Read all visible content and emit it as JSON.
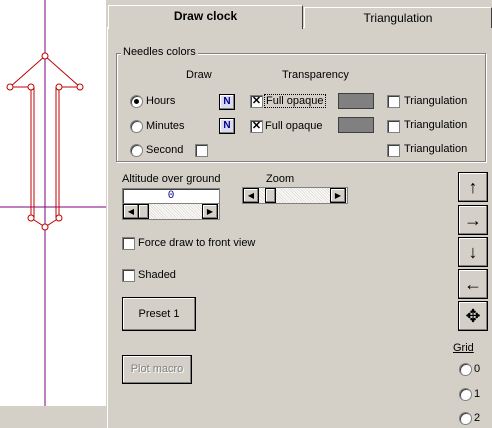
{
  "tabs": {
    "draw_clock": "Draw clock",
    "triangulation": "Triangulation"
  },
  "needles": {
    "title": "Needles colors",
    "col_draw": "Draw",
    "col_transparency": "Transparency",
    "rows": [
      {
        "label": "Hours",
        "selected": true,
        "n_label": "N",
        "opaque_label": "Full opaque",
        "opaque_checked": true,
        "tri_label": "Triangulation"
      },
      {
        "label": "Minutes",
        "selected": false,
        "n_label": "N",
        "opaque_label": "Full opaque",
        "opaque_checked": true,
        "tri_label": "Triangulation"
      },
      {
        "label": "Second",
        "selected": false,
        "tri_label": "Triangulation"
      }
    ]
  },
  "altitude": {
    "label": "Altitude over ground",
    "value": "0"
  },
  "zoom": {
    "label": "Zoom"
  },
  "options": {
    "force_front": "Force draw to front view",
    "shaded": "Shaded"
  },
  "buttons": {
    "preset": "Preset 1",
    "plot_macro": "Plot macro"
  },
  "grid": {
    "title": "Grid",
    "options": [
      "0",
      "1",
      "2"
    ]
  },
  "colors": {
    "needle": "#c00000",
    "axis": "#800080",
    "n_button": "#00008b"
  }
}
